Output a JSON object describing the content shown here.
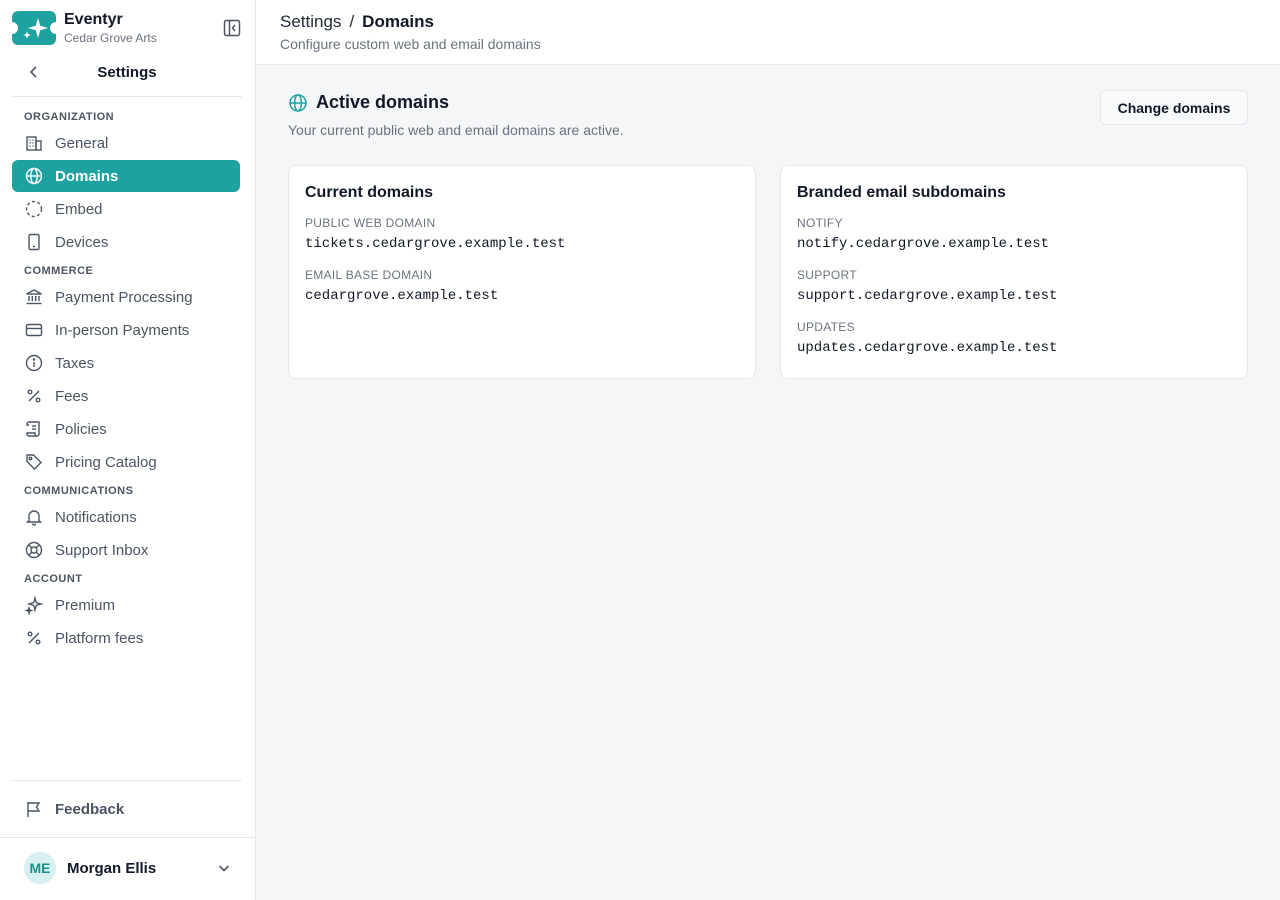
{
  "brand": {
    "name": "Eventyr",
    "org": "Cedar Grove Arts"
  },
  "settings_title": "Settings",
  "nav": {
    "sections": [
      {
        "label": "ORGANIZATION",
        "items": [
          {
            "label": "General",
            "icon": "building-icon"
          },
          {
            "label": "Domains",
            "icon": "globe-icon",
            "active": true
          },
          {
            "label": "Embed",
            "icon": "dashed-circle-icon"
          },
          {
            "label": "Devices",
            "icon": "tablet-icon"
          }
        ]
      },
      {
        "label": "COMMERCE",
        "items": [
          {
            "label": "Payment Processing",
            "icon": "bank-icon"
          },
          {
            "label": "In-person Payments",
            "icon": "credit-card-icon"
          },
          {
            "label": "Taxes",
            "icon": "info-icon"
          },
          {
            "label": "Fees",
            "icon": "percent-icon"
          },
          {
            "label": "Policies",
            "icon": "scroll-icon"
          },
          {
            "label": "Pricing Catalog",
            "icon": "tag-icon"
          }
        ]
      },
      {
        "label": "COMMUNICATIONS",
        "items": [
          {
            "label": "Notifications",
            "icon": "bell-icon"
          },
          {
            "label": "Support Inbox",
            "icon": "lifebuoy-icon"
          }
        ]
      },
      {
        "label": "ACCOUNT",
        "items": [
          {
            "label": "Premium",
            "icon": "sparkles-icon"
          },
          {
            "label": "Platform fees",
            "icon": "percent-icon"
          }
        ]
      }
    ]
  },
  "feedback": "Feedback",
  "user": {
    "initials": "ME",
    "name": "Morgan Ellis"
  },
  "header": {
    "crumb_root": "Settings",
    "crumb_sep": "/",
    "crumb_current": "Domains",
    "subtitle": "Configure custom web and email domains"
  },
  "main": {
    "title": "Active domains",
    "subtitle": "Your current public web and email domains are active.",
    "change_button": "Change domains",
    "current_card": {
      "title": "Current domains",
      "fields": [
        {
          "label": "PUBLIC WEB DOMAIN",
          "value": "tickets.cedargrove.example.test"
        },
        {
          "label": "EMAIL BASE DOMAIN",
          "value": "cedargrove.example.test"
        }
      ]
    },
    "branded_card": {
      "title": "Branded email subdomains",
      "fields": [
        {
          "label": "NOTIFY",
          "value": "notify.cedargrove.example.test"
        },
        {
          "label": "SUPPORT",
          "value": "support.cedargrove.example.test"
        },
        {
          "label": "UPDATES",
          "value": "updates.cedargrove.example.test"
        }
      ]
    }
  },
  "colors": {
    "accent": "#1ea2a0",
    "sidebar_bg": "#ffffff",
    "page_bg": "#f5f6f8",
    "border": "#e5e7eb"
  }
}
